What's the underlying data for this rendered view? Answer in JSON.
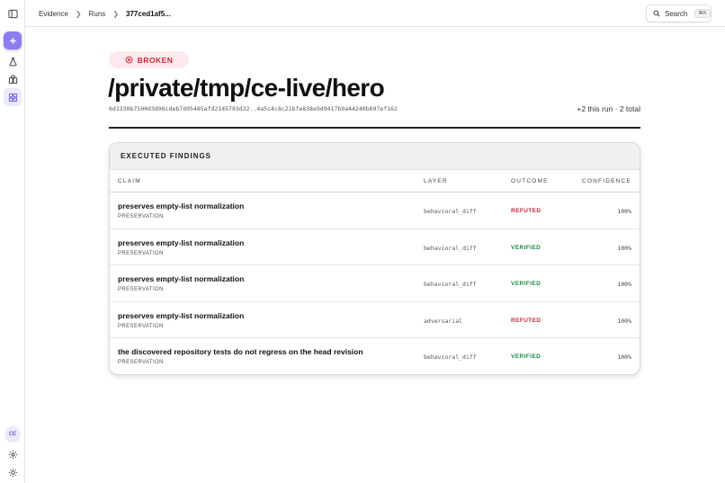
{
  "rail": {
    "avatar_initials": "CE"
  },
  "breadcrumb": {
    "items": [
      "Evidence",
      "Runs",
      "377ced1af5..."
    ]
  },
  "search": {
    "label": "Search",
    "shortcut": "⌘K"
  },
  "run": {
    "status": "BROKEN",
    "title": "/private/tmp/ce-live/hero",
    "hash": "6d1330b7500d3d96cdeb7d05485afd2145703d32..4a5c4c8c21bfe838e9d9417b9a44240b697ef162",
    "summary": "+2 this run · 2 total"
  },
  "findings": {
    "heading": "EXECUTED FINDINGS",
    "columns": {
      "claim": "CLAIM",
      "layer": "LAYER",
      "outcome": "OUTCOME",
      "confidence": "CONFIDENCE"
    },
    "rows": [
      {
        "claim": "preserves empty-list normalization",
        "category": "PRESERVATION",
        "layer": "behavioral_diff",
        "outcome": "REFUTED",
        "confidence": "100%"
      },
      {
        "claim": "preserves empty-list normalization",
        "category": "PRESERVATION",
        "layer": "behavioral_diff",
        "outcome": "VERIFIED",
        "confidence": "100%"
      },
      {
        "claim": "preserves empty-list normalization",
        "category": "PRESERVATION",
        "layer": "behavioral_diff",
        "outcome": "VERIFIED",
        "confidence": "100%"
      },
      {
        "claim": "preserves empty-list normalization",
        "category": "PRESERVATION",
        "layer": "adversarial",
        "outcome": "REFUTED",
        "confidence": "100%"
      },
      {
        "claim": "the discovered repository tests do not regress on the head revision",
        "category": "PRESERVATION",
        "layer": "behavioral_diff",
        "outcome": "VERIFIED",
        "confidence": "100%"
      }
    ]
  },
  "colors": {
    "accent": "#8b7cf0",
    "refuted": "#c4283c",
    "verified": "#1d8a45",
    "broken_bg": "#fdeaec"
  }
}
